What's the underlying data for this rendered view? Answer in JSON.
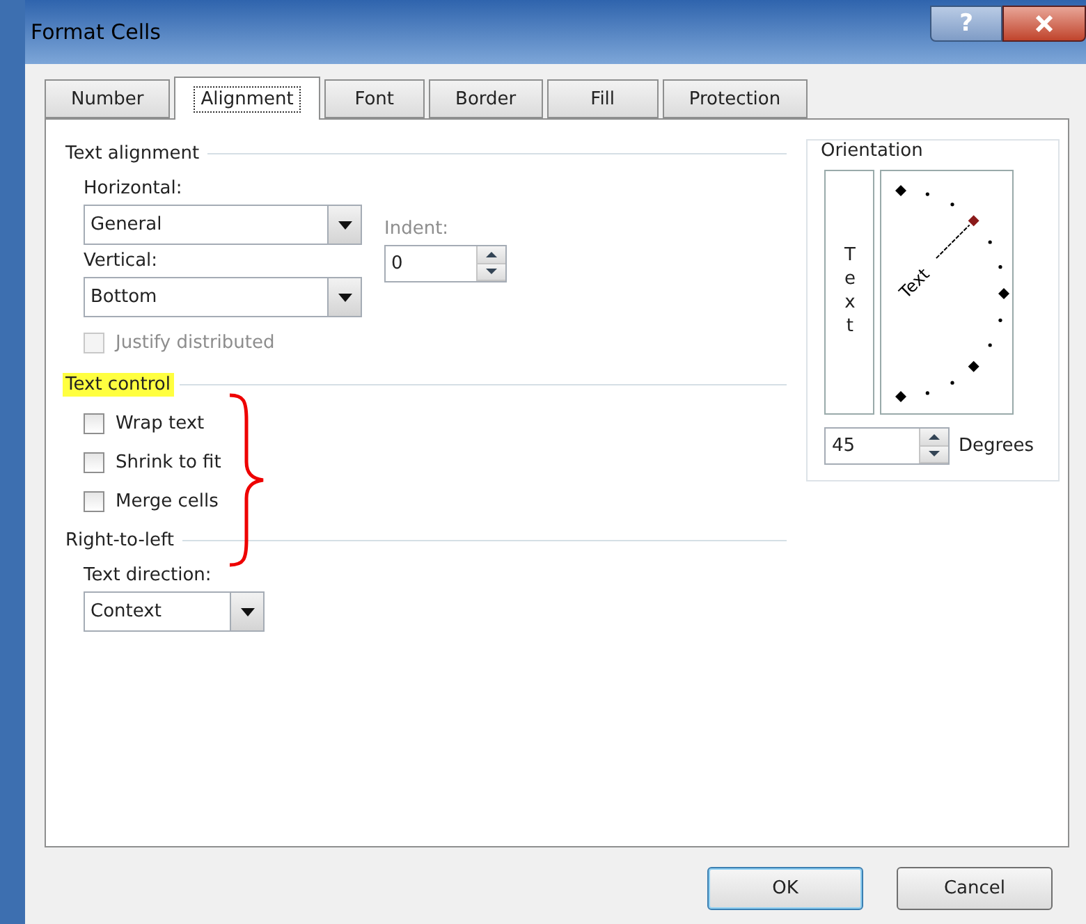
{
  "window": {
    "title": "Format Cells",
    "help_button": "?"
  },
  "tabs": [
    {
      "label": "Number",
      "selected": false
    },
    {
      "label": "Alignment",
      "selected": true
    },
    {
      "label": "Font",
      "selected": false
    },
    {
      "label": "Border",
      "selected": false
    },
    {
      "label": "Fill",
      "selected": false
    },
    {
      "label": "Protection",
      "selected": false
    }
  ],
  "text_alignment": {
    "heading": "Text alignment",
    "horizontal_label": "Horizontal:",
    "horizontal_value": "General",
    "vertical_label": "Vertical:",
    "vertical_value": "Bottom",
    "indent_label": "Indent:",
    "indent_value": "0",
    "justify": {
      "label": "Justify distributed",
      "checked": false,
      "disabled": true
    }
  },
  "text_control": {
    "heading": "Text control",
    "highlighted": true,
    "options": [
      {
        "label": "Wrap text",
        "checked": false
      },
      {
        "label": "Shrink to fit",
        "checked": false
      },
      {
        "label": "Merge cells",
        "checked": false
      }
    ]
  },
  "right_to_left": {
    "heading": "Right-to-left",
    "direction_label": "Text direction:",
    "direction_value": "Context"
  },
  "orientation": {
    "heading": "Orientation",
    "vertical_text": "Text",
    "dial_text": "Text",
    "degrees_value": "45",
    "degrees_label": "Degrees"
  },
  "buttons": [
    {
      "label": "OK",
      "default": true
    },
    {
      "label": "Cancel",
      "default": false
    }
  ]
}
